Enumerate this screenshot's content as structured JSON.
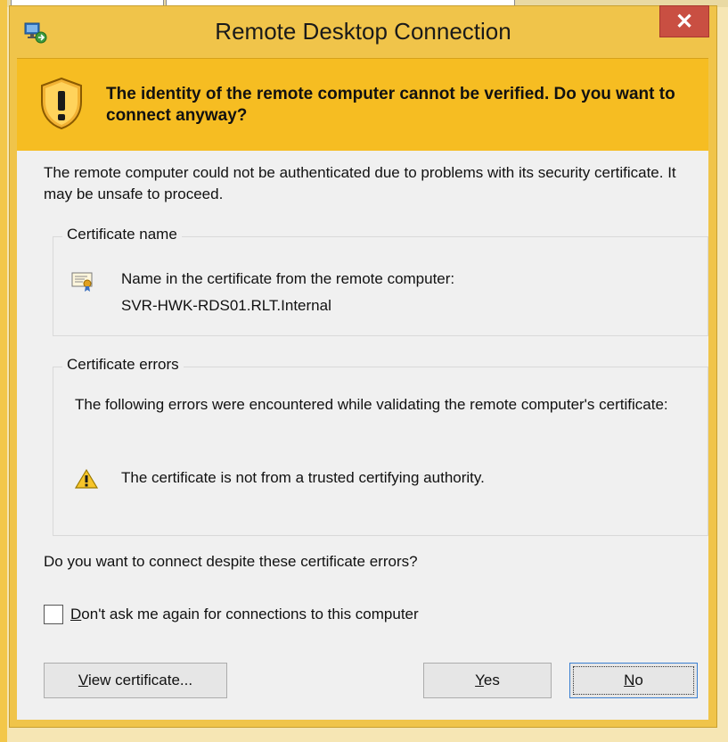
{
  "window": {
    "title": "Remote Desktop Connection",
    "close_label": "✕"
  },
  "banner": {
    "heading": "The identity of the remote computer cannot be verified. Do you want to connect anyway?"
  },
  "content": {
    "intro": "The remote computer could not be authenticated due to problems with its security certificate. It may be unsafe to proceed.",
    "certificate_name": {
      "legend": "Certificate name",
      "line1": "Name in the certificate from the remote computer:",
      "line2": "SVR-HWK-RDS01.RLT.Internal"
    },
    "certificate_errors": {
      "legend": "Certificate errors",
      "description": "The following errors were encountered while validating the remote computer's certificate:",
      "error1": "The certificate is not from a trusted certifying authority."
    },
    "question": "Do you want to connect despite these certificate errors?",
    "checkbox_label_mnemonic": "D",
    "checkbox_label_rest": "on't ask me again for connections to this computer"
  },
  "buttons": {
    "view_mnemonic": "V",
    "view_rest": "iew certificate...",
    "yes_mnemonic": "Y",
    "yes_rest": "es",
    "no_mnemonic": "N",
    "no_rest": "o"
  },
  "colors": {
    "banner": "#f6bd22",
    "frame": "#f0c44a",
    "close": "#c94f42",
    "content_bg": "#f0f0f0"
  },
  "icons": {
    "app": "remote-desktop-icon",
    "shield": "warning-shield-icon",
    "certificate": "certificate-icon",
    "warning": "warning-triangle-icon"
  }
}
